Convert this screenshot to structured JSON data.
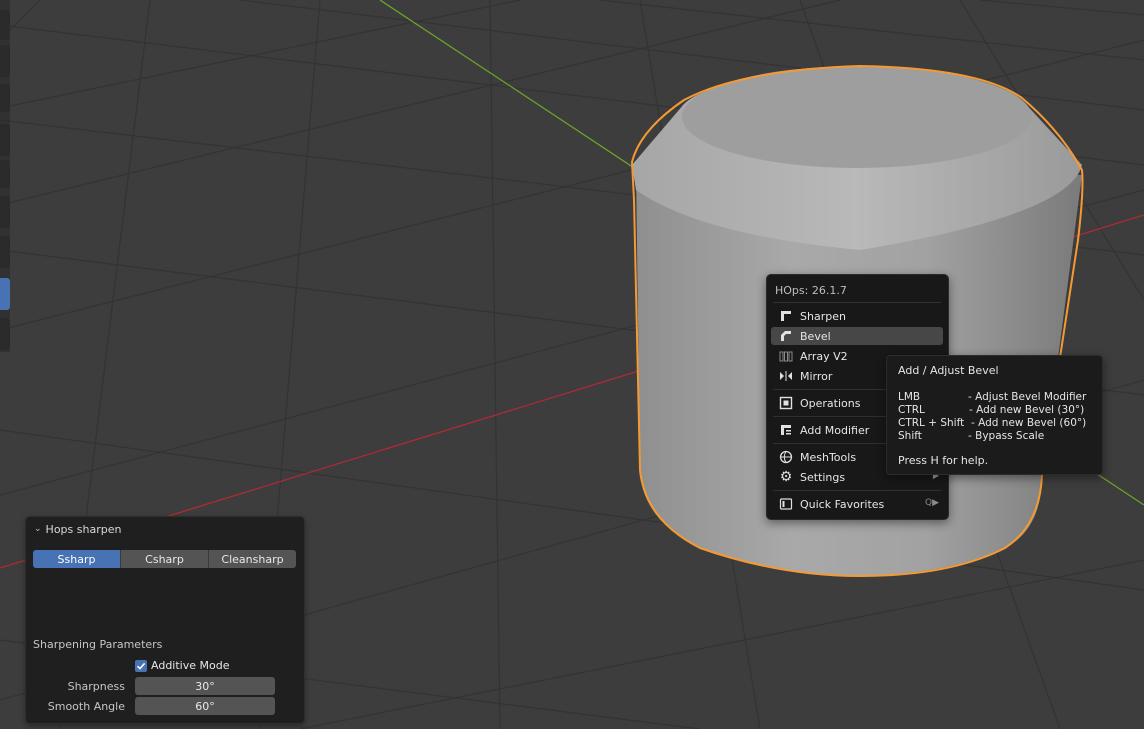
{
  "operator_panel": {
    "title": "Hops sharpen",
    "modes": [
      "Ssharp",
      "Csharp",
      "Cleansharp"
    ],
    "active_mode": "Ssharp",
    "section_label": "Sharpening Parameters",
    "additive_mode": {
      "label": "Additive Mode",
      "checked": true
    },
    "sharpness": {
      "label": "Sharpness",
      "value": "30°"
    },
    "smooth_angle": {
      "label": "Smooth Angle",
      "value": "60°"
    }
  },
  "hops_menu": {
    "title": "HOps: 26.1.7",
    "items": [
      {
        "label": "Sharpen",
        "icon": "sharpen-icon"
      },
      {
        "label": "Bevel",
        "icon": "bevel-icon",
        "highlighted": true
      },
      {
        "label": "Array V2",
        "icon": "array-icon"
      },
      {
        "label": "Mirror",
        "icon": "mirror-icon"
      },
      {
        "label": "Operations",
        "icon": "operations-icon",
        "submenu": true
      },
      {
        "label": "Add Modifier",
        "icon": "modifier-icon",
        "submenu": true
      },
      {
        "label": "MeshTools",
        "icon": "meshtools-icon",
        "submenu": true
      },
      {
        "label": "Settings",
        "icon": "gear-icon",
        "submenu": true
      },
      {
        "label": "Quick Favorites",
        "icon": "favorites-icon",
        "shortcut": "Q"
      }
    ]
  },
  "tooltip": {
    "title": "Add / Adjust Bevel",
    "rows": [
      {
        "key": "LMB",
        "desc": "- Adjust Bevel Modifier"
      },
      {
        "key": "CTRL",
        "desc": "- Add new Bevel (30°)"
      },
      {
        "key": "CTRL + Shift",
        "desc": "- Add new Bevel (60°)"
      },
      {
        "key": "Shift",
        "desc": "- Bypass Scale"
      }
    ],
    "help": "Press H for help."
  },
  "colors": {
    "viewport_bg": "#3d3d3d",
    "grid": "#333333",
    "x_axis": "#b02a33",
    "y_axis": "#6aa12c",
    "selection_outline": "#f59a33",
    "active_blue": "#4772b3"
  }
}
